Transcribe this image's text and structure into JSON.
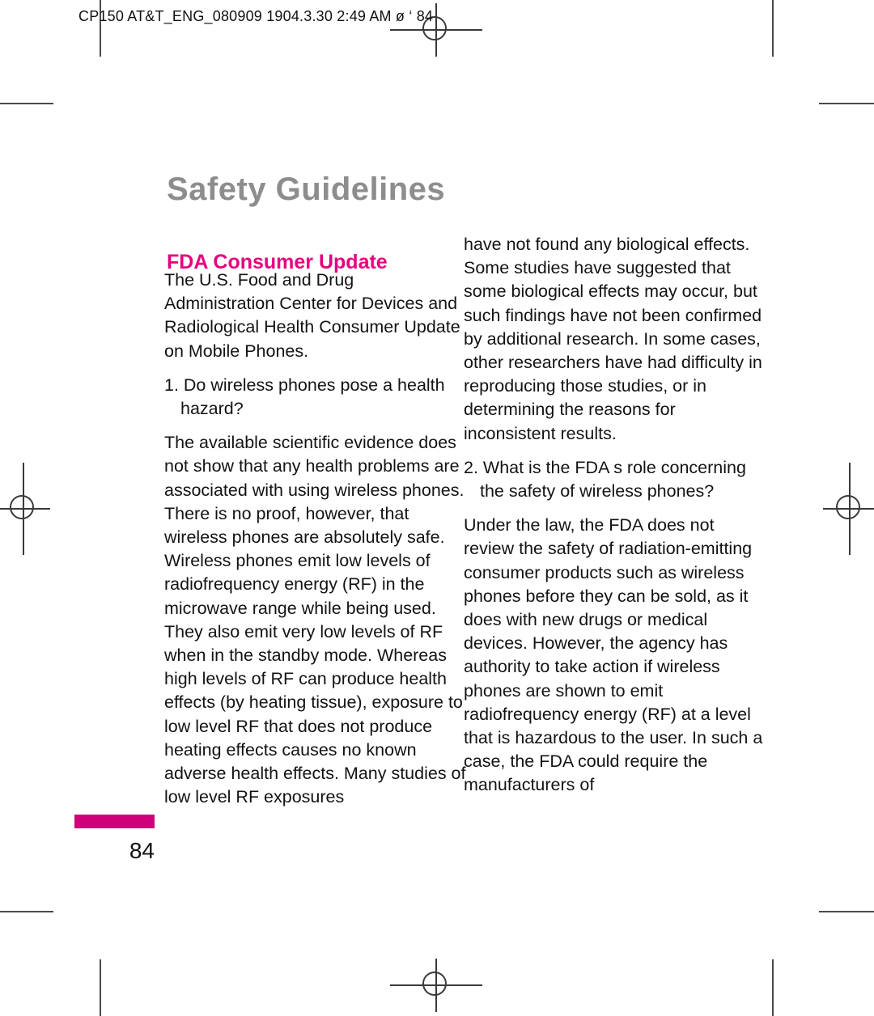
{
  "print_header": "CP150 AT&T_ENG_080909  1904.3.30 2:49 AM  ø    ‘ 84",
  "page": {
    "title": "Safety Guidelines",
    "number": "84",
    "accent_bar_color": "#cf0079",
    "heading_color": "#e6007e",
    "title_color": "#8d8d8d"
  },
  "section": {
    "heading": "FDA Consumer Update"
  },
  "left_column": {
    "paragraphs": [
      "The U.S. Food and Drug Administration Center for Devices and Radiological Health Consumer Update on Mobile Phones.",
      "1. Do wireless phones pose a health hazard?",
      "The available scientific evidence does not show that any health problems are associated with using wireless phones. There is no proof, however, that wireless phones are absolutely safe. Wireless phones emit low levels of radiofrequency energy (RF) in the microwave range while being used. They also emit very low levels of RF when in the standby mode. Whereas high levels of RF can produce health effects (by heating tissue), exposure to low level RF that does not produce heating effects causes no known adverse health effects. Many studies of low level RF exposures"
    ]
  },
  "right_column": {
    "paragraphs": [
      "have not found any biological effects. Some studies have suggested that some biological effects may occur, but such findings have not been confirmed by additional research. In some cases, other researchers have had difficulty in reproducing those studies, or in determining the reasons for inconsistent results.",
      "2. What is the FDA s role concerning the safety of wireless phones?",
      "Under the law, the FDA does not review the safety of radiation-emitting consumer products such as wireless phones before they can be sold, as it does with new drugs or medical devices. However, the agency has authority to take action if wireless phones are shown to emit radiofrequency energy (RF) at a level that is hazardous to the user. In such a case, the FDA could require the manufacturers of"
    ]
  },
  "marks": {
    "registration_mark_icon": "registration-crosshair",
    "crop_mark_icon": "crop-line"
  }
}
